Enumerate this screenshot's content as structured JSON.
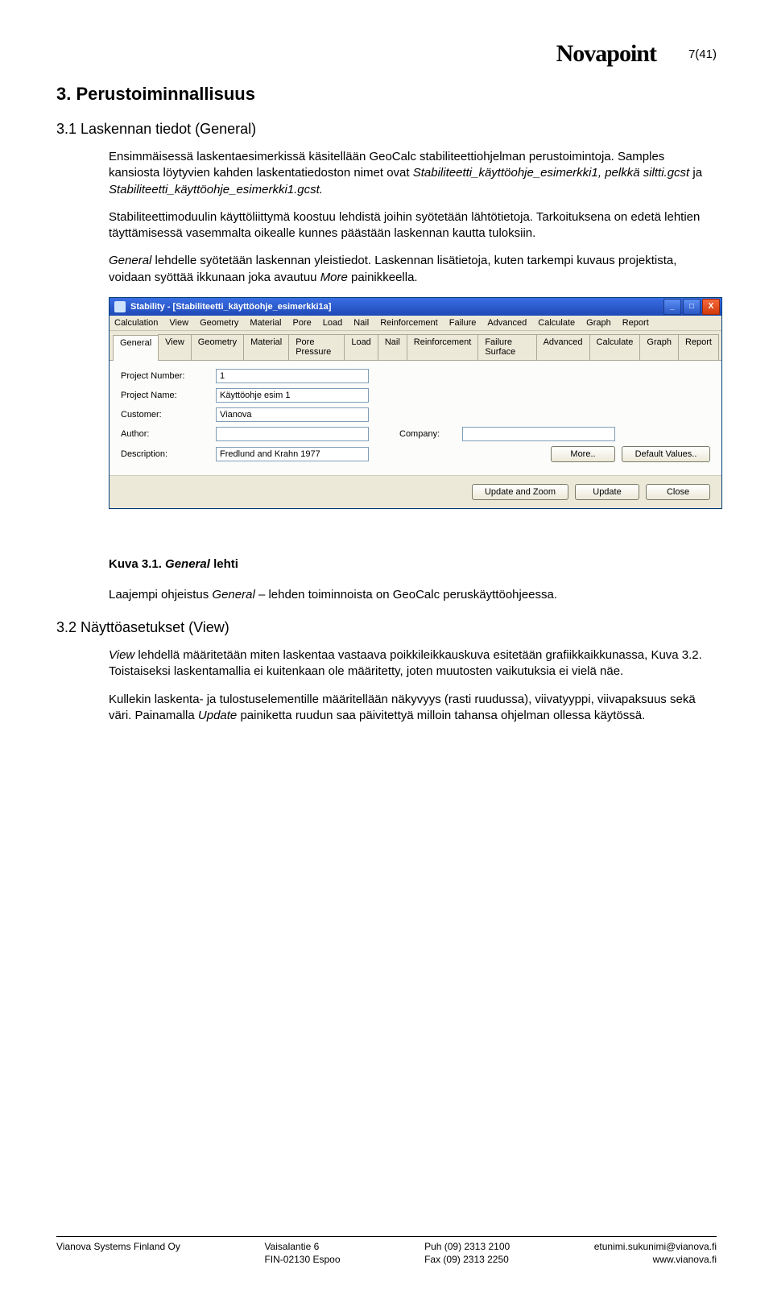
{
  "header": {
    "logo": "Novapoint",
    "page_counter": "7(41)"
  },
  "section3": {
    "heading": "3.  Perustoiminnallisuus",
    "sub31_heading": "3.1  Laskennan tiedot (General)",
    "p1": "Ensimmäisessä laskentaesimerkissä käsitellään GeoCalc stabiliteettiohjelman perustoimintoja. Samples kansiosta löytyvien kahden laskentatiedoston nimet ovat ",
    "p1_file1": "Stabiliteetti_käyttöohje_esimerkki1, pelkkä siltti.gcst",
    "p1_mid": " ja ",
    "p1_file2": "Stabiliteetti_käyttöohje_esimerkki1.gcst.",
    "p2": "Stabiliteettimoduulin käyttöliittymä koostuu lehdistä joihin syötetään lähtötietoja. Tarkoituksena on edetä lehtien täyttämisessä vasemmalta oikealle kunnes päästään laskennan kautta tuloksiin.",
    "p3_a": "General",
    "p3_b": " lehdelle syötetään laskennan yleistiedot. Laskennan lisätietoja, kuten tarkempi kuvaus projektista, voidaan syöttää ikkunaan joka avautuu ",
    "p3_c": "More",
    "p3_d": " painikkeella.",
    "caption_a": "Kuva 3.1. ",
    "caption_b": "General",
    "caption_c": " lehti",
    "p4_a": "Laajempi ohjeistus ",
    "p4_b": "General",
    "p4_c": " – lehden toiminnoista on GeoCalc peruskäyttöohjeessa.",
    "sub32_heading": "3.2  Näyttöasetukset (View)",
    "p5_a": "View",
    "p5_b": " lehdellä määritetään miten laskentaa vastaava poikkileikkauskuva esitetään grafiikkaikkunassa, Kuva 3.2. Toistaiseksi laskentamallia ei kuitenkaan ole määritetty, joten muutosten vaikutuksia ei vielä näe.",
    "p6_a": "Kullekin laskenta- ja tulostuselementille määritellään näkyvyys (rasti ruudussa), viivatyyppi, viivapaksuus sekä väri. Painamalla ",
    "p6_b": "Update",
    "p6_c": " painiketta ruudun saa päivitettyä milloin tahansa ohjelman ollessa käytössä."
  },
  "appwindow": {
    "title": "Stability - [Stabiliteetti_käyttöohje_esimerkki1a]",
    "menus": [
      "Calculation",
      "View",
      "Geometry",
      "Material",
      "Pore",
      "Load",
      "Nail",
      "Reinforcement",
      "Failure",
      "Advanced",
      "Calculate",
      "Graph",
      "Report"
    ],
    "tabs": [
      "General",
      "View",
      "Geometry",
      "Material",
      "Pore Pressure",
      "Load",
      "Nail",
      "Reinforcement",
      "Failure Surface",
      "Advanced",
      "Calculate",
      "Graph",
      "Report"
    ],
    "labels": {
      "project_number": "Project Number:",
      "project_name": "Project Name:",
      "customer": "Customer:",
      "author": "Author:",
      "company": "Company:",
      "description": "Description:"
    },
    "values": {
      "project_number": "1",
      "project_name": "Käyttöohje esim 1",
      "customer": "Vianova",
      "author": "",
      "company": "",
      "description": "Fredlund and Krahn 1977"
    },
    "buttons": {
      "more": "More..",
      "default": "Default Values..",
      "update_zoom": "Update and Zoom",
      "update": "Update",
      "close": "Close"
    },
    "winbtns": {
      "min": "_",
      "max": "□",
      "close": "X"
    }
  },
  "footer": {
    "col1a": "Vianova Systems Finland Oy",
    "col2a": "Vaisalantie 6",
    "col2b": "FIN-02130 Espoo",
    "col3a": "Puh  (09) 2313 2100",
    "col3b": "Fax  (09) 2313 2250",
    "col4a": "etunimi.sukunimi@vianova.fi",
    "col4b": "www.vianova.fi"
  }
}
